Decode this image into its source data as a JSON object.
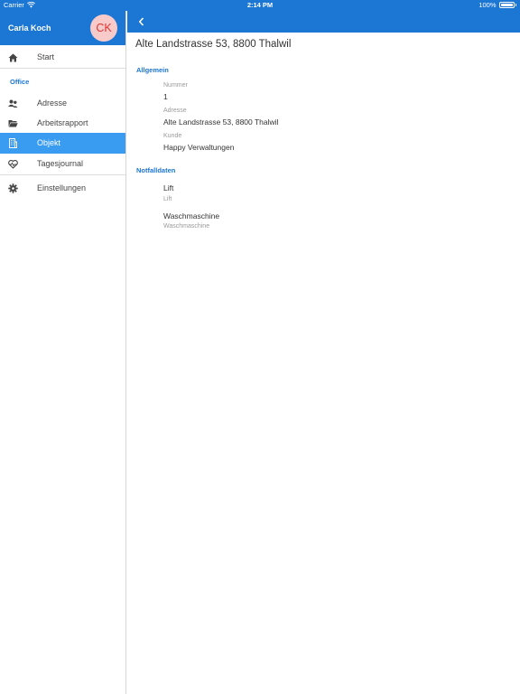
{
  "status_bar": {
    "carrier": "Carrier",
    "time": "2:14 PM",
    "battery": "100%",
    "battery_level": 1.0
  },
  "sidebar": {
    "user_name": "Carla Koch",
    "avatar_initials": "CK",
    "items": [
      {
        "label": "Start",
        "icon": "home-icon"
      },
      {
        "label": "Adresse",
        "icon": "contacts-icon"
      },
      {
        "label": "Arbeitsrapport",
        "icon": "folder-open-icon"
      },
      {
        "label": "Objekt",
        "icon": "building-icon"
      },
      {
        "label": "Tagesjournal",
        "icon": "heart-pulse-icon"
      },
      {
        "label": "Einstellungen",
        "icon": "gear-icon"
      }
    ],
    "office_section": "Office",
    "active_item": "Objekt"
  },
  "main": {
    "title": "Alte Landstrasse 53, 8800 Thalwil",
    "groups": {
      "allgemein": {
        "header": "Allgemein",
        "fields": [
          {
            "label": "Nummer",
            "value": "1"
          },
          {
            "label": "Adresse",
            "value": "Alte Landstrasse 53, 8800 Thalwil"
          },
          {
            "label": "Kunde",
            "value": "Happy Verwaltungen"
          }
        ]
      },
      "notfalldaten": {
        "header": "Notfalldaten",
        "entries": [
          {
            "title": "Lift",
            "subtitle": "Lift"
          },
          {
            "title": "Waschmaschine",
            "subtitle": "Waschmaschine"
          }
        ]
      }
    }
  },
  "colors": {
    "primary": "#1c76d3",
    "active_item": "#3a9cf0",
    "avatar_bg": "#f8caca",
    "avatar_text": "#e03434"
  }
}
